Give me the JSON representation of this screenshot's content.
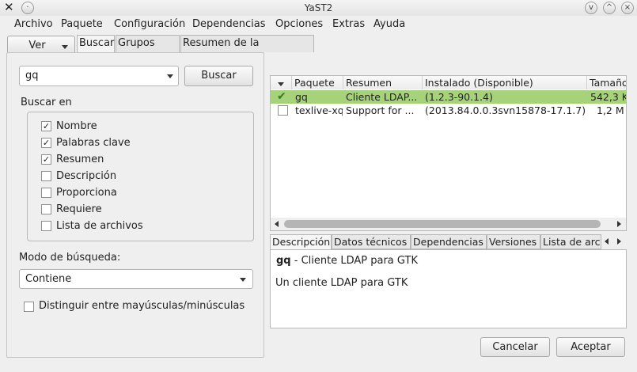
{
  "window": {
    "title": "YaST2",
    "close": "×",
    "maximize": "^",
    "minimize": "v"
  },
  "menu": [
    "Archivo",
    "Paquete",
    "Configuración",
    "Dependencias",
    "Opciones",
    "Extras",
    "Ayuda"
  ],
  "view_button": "Ver",
  "tabs": [
    "Buscar",
    "Grupos RPM",
    "Resumen de la instalación"
  ],
  "search": {
    "value": "gq",
    "button": "Buscar"
  },
  "search_in": {
    "label": "Buscar en",
    "options": [
      {
        "label": "Nombre",
        "checked": true
      },
      {
        "label": "Palabras clave",
        "checked": true
      },
      {
        "label": "Resumen",
        "checked": true
      },
      {
        "label": "Descripción",
        "checked": false
      },
      {
        "label": "Proporciona",
        "checked": false
      },
      {
        "label": "Requiere",
        "checked": false
      },
      {
        "label": "Lista de archivos",
        "checked": false
      }
    ]
  },
  "search_mode": {
    "label": "Modo de búsqueda:",
    "value": "Contiene"
  },
  "case_sensitive": {
    "label": "Distinguir entre mayúsculas/minúsculas",
    "checked": false
  },
  "table": {
    "headers": [
      "Paquete",
      "Resumen",
      "Instalado (Disponible)",
      "Tamaño"
    ],
    "rows": [
      {
        "status": "installed",
        "package": "gq",
        "summary": "Cliente LDAP...",
        "installed": "(1.2.3-90.1.4)",
        "size": "542,3 K"
      },
      {
        "status": "none",
        "package": "texlive-xq",
        "summary": "Support for ...",
        "installed": "(2013.84.0.0.3svn15878-17.1.7)",
        "size": "1,2 M"
      }
    ]
  },
  "details_tabs": [
    "Descripción",
    "Datos técnicos",
    "Dependencias",
    "Versiones",
    "Lista de arc"
  ],
  "details": {
    "name": "gq",
    "summary": " - Cliente LDAP para GTK",
    "description": "Un cliente LDAP para GTK"
  },
  "buttons": {
    "cancel": "Cancelar",
    "accept": "Aceptar"
  },
  "colors": {
    "selected_row": "#a6d37a",
    "check_green": "#3b8f2f"
  }
}
